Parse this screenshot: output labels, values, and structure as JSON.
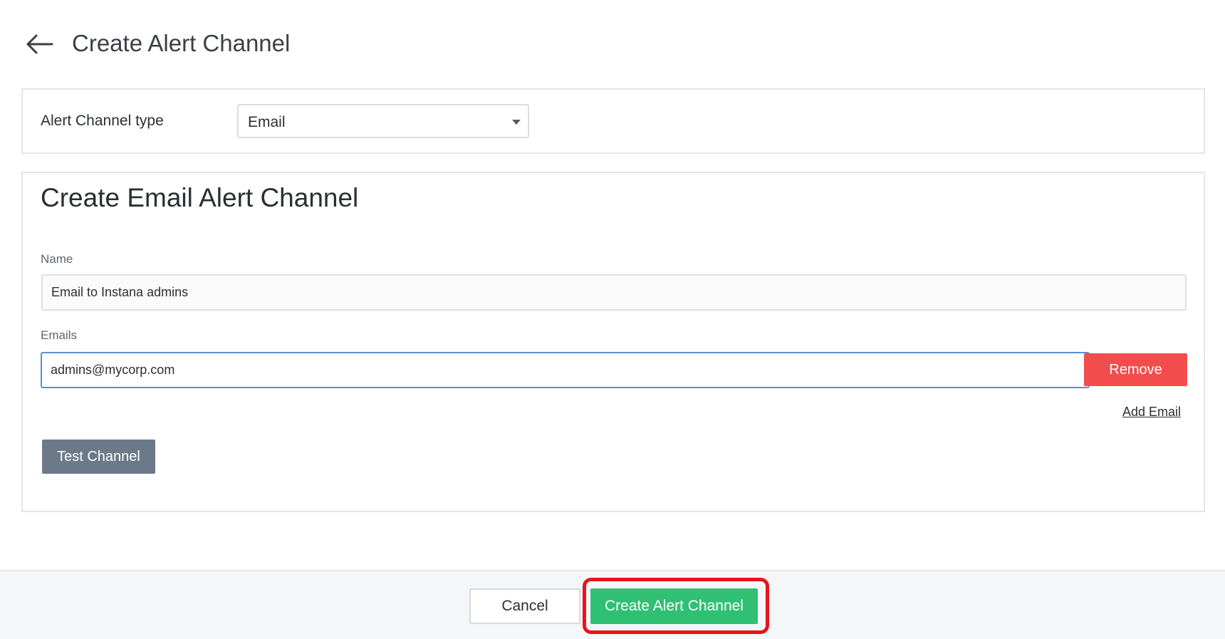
{
  "header": {
    "back_icon": "arrow-left-icon",
    "title": "Create Alert Channel"
  },
  "channel_type": {
    "label": "Alert Channel type",
    "selected": "Email",
    "caret_icon": "caret-down-icon"
  },
  "form": {
    "title": "Create Email Alert Channel",
    "name_label": "Name",
    "name_value": "Email to Instana admins",
    "emails_label": "Emails",
    "email_value": "admins@mycorp.com",
    "remove_label": "Remove",
    "add_email_label": "Add Email",
    "test_label": "Test Channel"
  },
  "footer": {
    "cancel_label": "Cancel",
    "create_label": "Create Alert Channel"
  },
  "colors": {
    "remove": "#f34c4c",
    "create": "#2fc074",
    "test": "#6b7989",
    "highlight": "#e8131b",
    "focus_border": "#5b8fd6"
  }
}
